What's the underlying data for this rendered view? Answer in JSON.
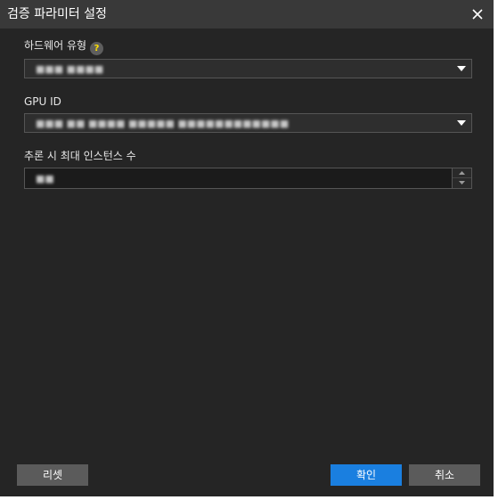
{
  "dialog": {
    "title": "검증 파라미터 설정",
    "close_icon": "close-icon"
  },
  "hardware_type": {
    "label": "하드웨어 유형",
    "help_icon": "help-icon",
    "help_glyph": "?",
    "value": "■■■ ■■■■"
  },
  "gpu_id": {
    "label": "GPU ID",
    "value": "■■■ ■■ ■■■■ ■■■■■ ■■■■■■■■■■■■"
  },
  "max_instances": {
    "label": "추론 시 최대 인스턴스 수",
    "value": "■■"
  },
  "buttons": {
    "reset": "리셋",
    "ok": "확인",
    "cancel": "취소"
  },
  "colors": {
    "accent": "#1a7fe0",
    "background": "#252525",
    "titlebar": "#393939"
  }
}
